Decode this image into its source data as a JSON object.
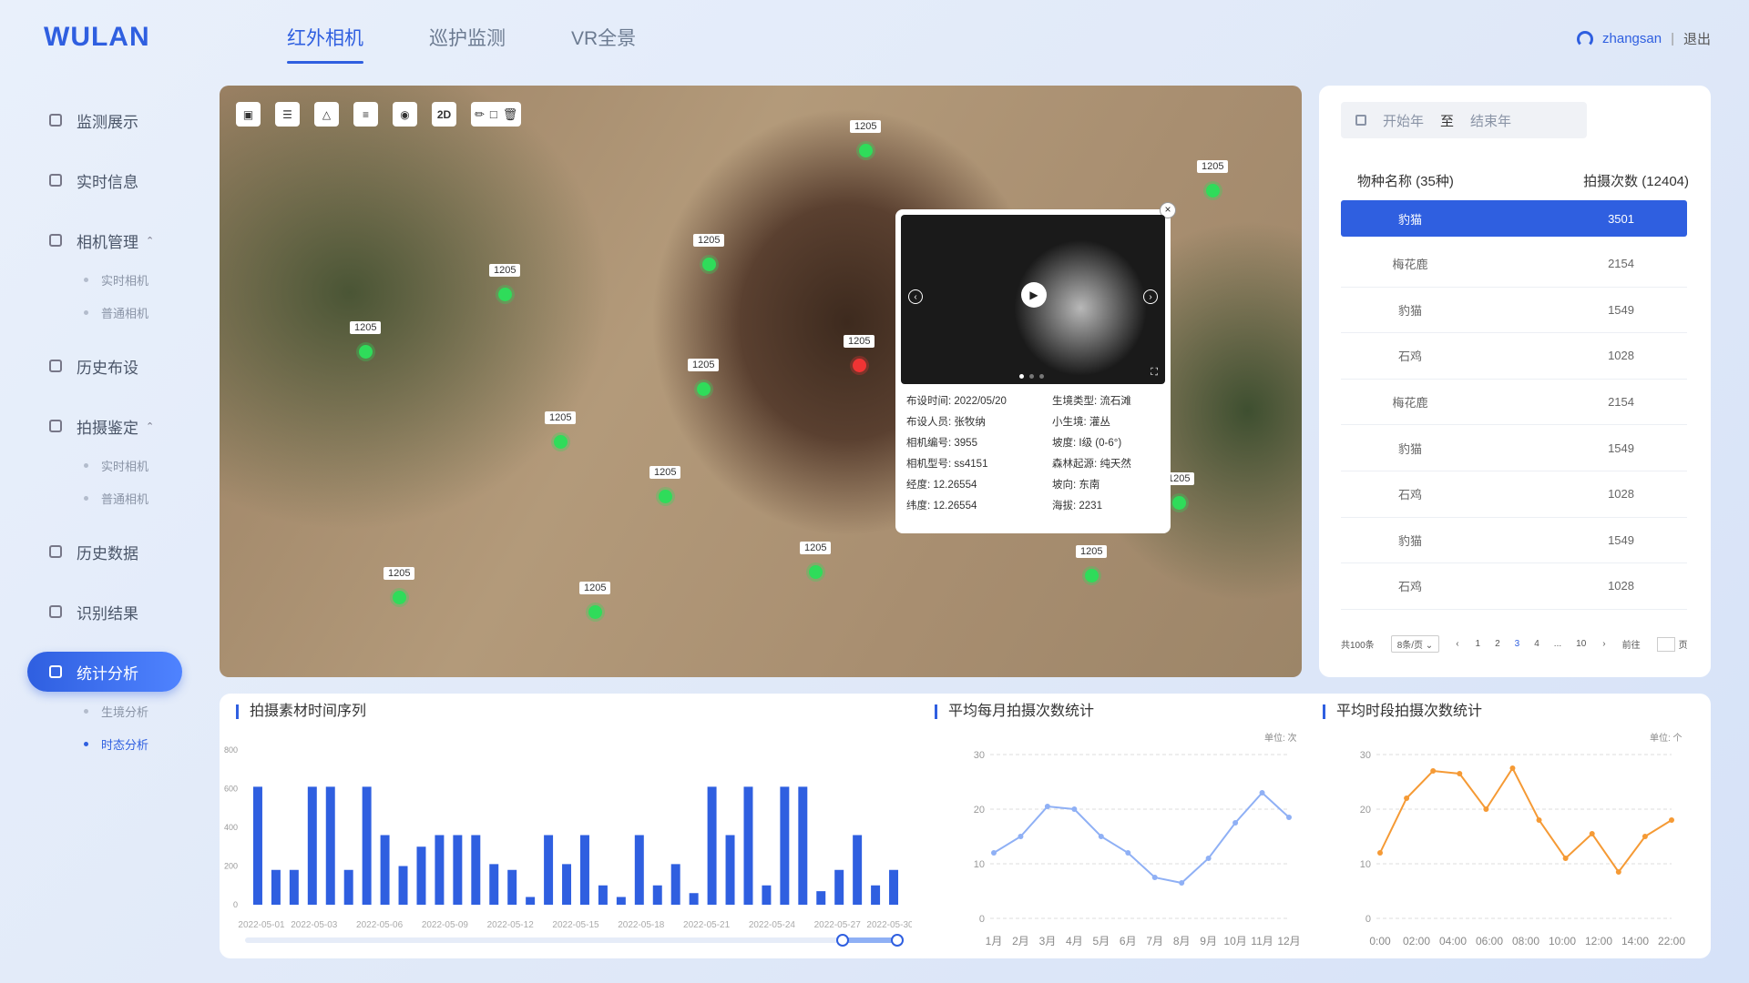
{
  "brand": {
    "logo": "WULAN"
  },
  "topnav": {
    "tabs": [
      {
        "label": "红外相机",
        "active": true
      },
      {
        "label": "巡护监测",
        "active": false
      },
      {
        "label": "VR全景",
        "active": false
      }
    ]
  },
  "user": {
    "name": "zhangsan",
    "separator": "|",
    "logout": "退出"
  },
  "sidebar": {
    "monitor": "监测展示",
    "realtime_info": "实时信息",
    "camera_mgmt": "相机管理",
    "camera_sub1": "实时相机",
    "camera_sub2": "普通相机",
    "history_deploy": "历史布设",
    "shoot_identify": "拍摄鉴定",
    "shoot_sub1": "实时相机",
    "shoot_sub2": "普通相机",
    "history_data": "历史数据",
    "recog_result": "识别结果",
    "stats": "统计分析",
    "stats_sub1": "生境分析",
    "stats_sub2": "时态分析"
  },
  "map": {
    "toolbar_2d": "2D",
    "markers": [
      "1205",
      "1205",
      "1205",
      "1205",
      "1205",
      "1205",
      "1205",
      "1205",
      "1205",
      "1205",
      "1205",
      "1205",
      "1205",
      "1205",
      "1205"
    ],
    "popup": {
      "info": [
        {
          "k": "布设时间:",
          "v": "2022/05/20"
        },
        {
          "k": "生境类型:",
          "v": "流石滩"
        },
        {
          "k": "布设人员:",
          "v": "张牧纳"
        },
        {
          "k": "小生境:",
          "v": "灌丛"
        },
        {
          "k": "相机编号:",
          "v": "3955"
        },
        {
          "k": "坡度:",
          "v": "I级 (0-6°)"
        },
        {
          "k": "相机型号:",
          "v": "ss4151"
        },
        {
          "k": "森林起源:",
          "v": "纯天然"
        },
        {
          "k": "经度:",
          "v": "12.26554"
        },
        {
          "k": "坡向:",
          "v": "东南"
        },
        {
          "k": "纬度:",
          "v": "12.26554"
        },
        {
          "k": "海拔:",
          "v": "2231"
        }
      ]
    }
  },
  "right_panel": {
    "start": "开始年",
    "to": "至",
    "end": "结束年",
    "col1": "物种名称 (35种)",
    "col2": "拍摄次数 (12404)",
    "rows": [
      {
        "name": "豹猫",
        "count": "3501"
      },
      {
        "name": "梅花鹿",
        "count": "2154"
      },
      {
        "name": "豹猫",
        "count": "1549"
      },
      {
        "name": "石鸡",
        "count": "1028"
      },
      {
        "name": "梅花鹿",
        "count": "2154"
      },
      {
        "name": "豹猫",
        "count": "1549"
      },
      {
        "name": "石鸡",
        "count": "1028"
      },
      {
        "name": "豹猫",
        "count": "1549"
      },
      {
        "name": "石鸡",
        "count": "1028"
      }
    ],
    "pager": {
      "total": "共100条",
      "size": "8条/页",
      "pages": [
        "1",
        "2",
        "3",
        "4",
        "...",
        "10"
      ],
      "current": "3",
      "goto": "前往",
      "page_unit": "页"
    }
  },
  "chart_data": [
    {
      "type": "bar",
      "title": "拍摄素材时间序列",
      "ylim": [
        0,
        800
      ],
      "yticks": [
        "0",
        "200",
        "400",
        "600",
        "800"
      ],
      "tick_labels": [
        "2022-05-01",
        "2022-05-03",
        "2022-05-06",
        "2022-05-09",
        "2022-05-12",
        "2022-05-15",
        "2022-05-18",
        "2022-05-21",
        "2022-05-24",
        "2022-05-27",
        "2022-05-30"
      ],
      "values": [
        610,
        180,
        180,
        610,
        610,
        180,
        610,
        360,
        200,
        300,
        360,
        360,
        360,
        210,
        180,
        40,
        360,
        210,
        360,
        100,
        40,
        360,
        100,
        210,
        60,
        610,
        360,
        610,
        100,
        610,
        610,
        70,
        180,
        360,
        100,
        180
      ],
      "color": "#2f5fe0"
    },
    {
      "type": "line",
      "title": "平均每月拍摄次数统计",
      "unit": "单位: 次",
      "ylim": [
        0,
        30
      ],
      "yticks": [
        "0",
        "10",
        "20",
        "30"
      ],
      "categories": [
        "1月",
        "2月",
        "3月",
        "4月",
        "5月",
        "6月",
        "7月",
        "8月",
        "9月",
        "10月",
        "11月",
        "12月"
      ],
      "values": [
        12,
        15,
        20.5,
        20,
        15,
        12,
        7.5,
        6.5,
        11,
        17.5,
        23,
        18.5
      ],
      "color": "#8fb0f5"
    },
    {
      "type": "line",
      "title": "平均时段拍摄次数统计",
      "unit": "单位: 个",
      "ylim": [
        0,
        30
      ],
      "yticks": [
        "0",
        "10",
        "20",
        "30"
      ],
      "categories": [
        "0:00",
        "02:00",
        "04:00",
        "06:00",
        "08:00",
        "10:00",
        "12:00",
        "14:00",
        "22:00"
      ],
      "values": [
        12,
        22,
        27,
        26.5,
        20,
        27.5,
        18,
        11,
        15.5,
        8.5,
        15,
        18
      ],
      "color": "#f59a35"
    }
  ]
}
